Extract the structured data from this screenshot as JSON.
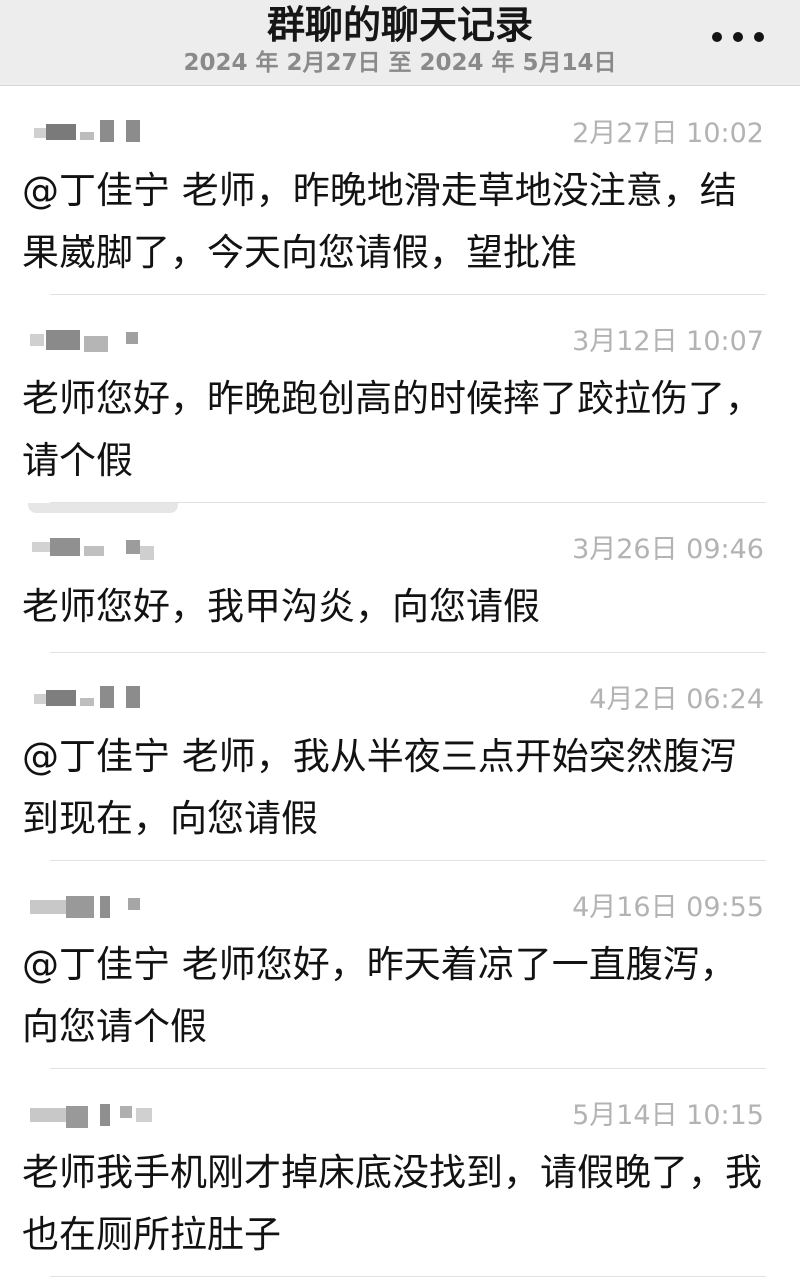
{
  "header": {
    "title": "群聊的聊天记录",
    "date_range": "2024 年 2月27日 至 2024 年 5月14日",
    "more_icon": "more-horizontal-icon"
  },
  "messages": [
    {
      "time": "2月27日 10:02",
      "text": "@丁佳宁 老师，昨晚地滑走草地没注意，结果崴脚了，今天向您请假，望批准"
    },
    {
      "time": "3月12日 10:07",
      "text": "老师您好，昨晚跑创高的时候摔了跤拉伤了，请个假"
    },
    {
      "time": "3月26日 09:46",
      "text": "老师您好，我甲沟炎，向您请假"
    },
    {
      "time": "4月2日 06:24",
      "text": "@丁佳宁 老师，我从半夜三点开始突然腹泻到现在，向您请假"
    },
    {
      "time": "4月16日 09:55",
      "text": "@丁佳宁 老师您好，昨天着凉了一直腹泻，向您请个假"
    },
    {
      "time": "5月14日 10:15",
      "text": "老师我手机刚才掉床底没找到，请假晚了，我也在厕所拉肚子"
    }
  ]
}
